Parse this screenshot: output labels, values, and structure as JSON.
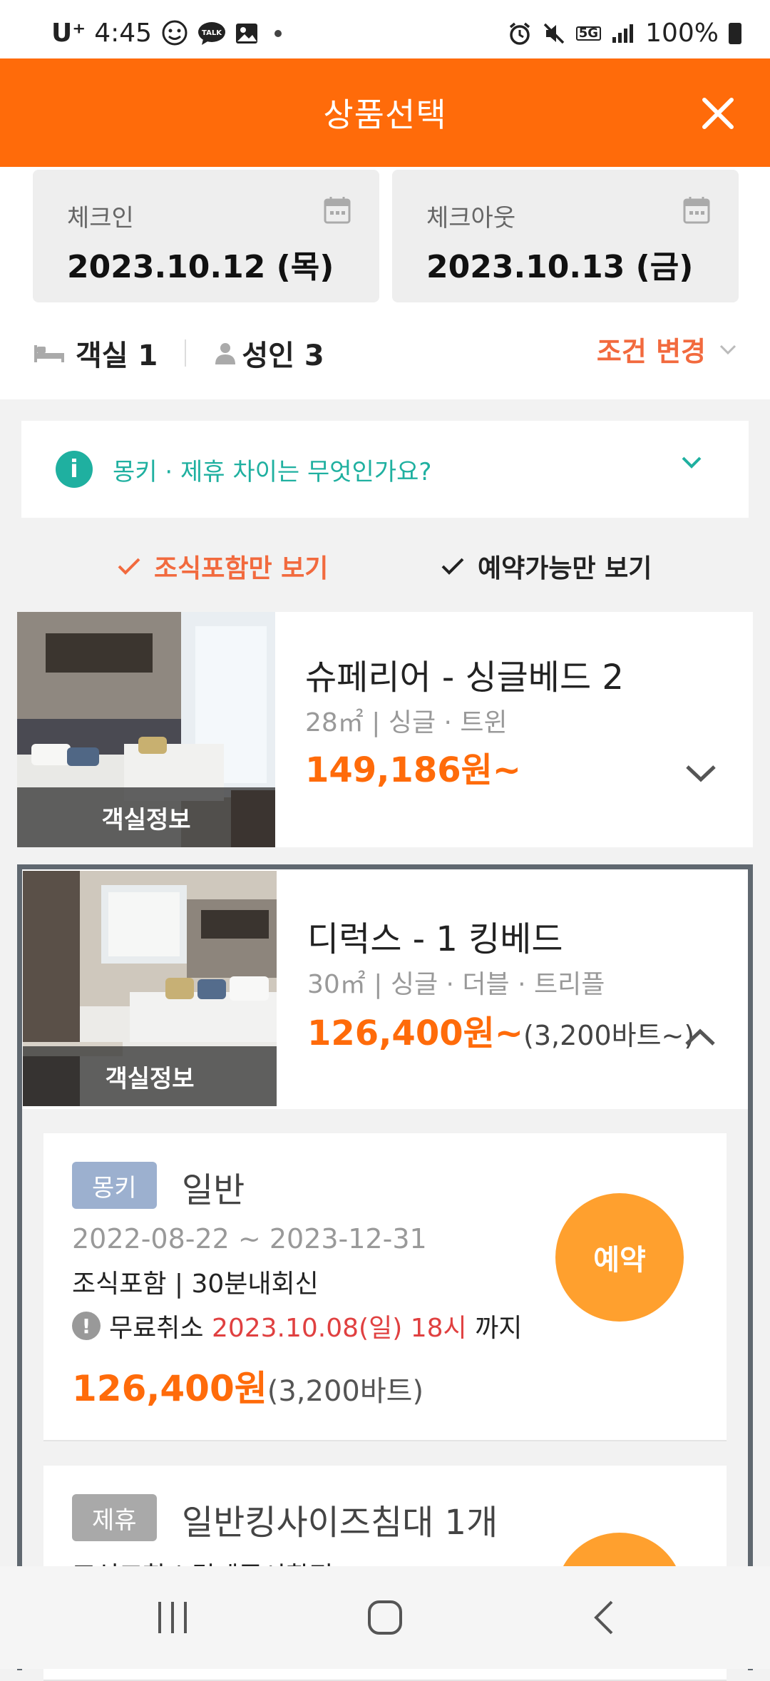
{
  "status_bar": {
    "carrier": "U⁺",
    "time": "4:45",
    "network": "5G",
    "battery": "100%",
    "left_icons": [
      "smiley-app-icon",
      "talk-bubble-icon",
      "gallery-icon",
      "dot"
    ],
    "right_icons": [
      "alarm-icon",
      "mute-icon",
      "5g-icon",
      "signal-icon",
      "battery-icon"
    ]
  },
  "header": {
    "title": "상품선택"
  },
  "dates": {
    "checkin_label": "체크인",
    "checkin_value": "2023.10.12 (목)",
    "checkout_label": "체크아웃",
    "checkout_value": "2023.10.13 (금)"
  },
  "conditions": {
    "rooms": "객실 1",
    "adults": "성인 3",
    "change_label": "조건 변경"
  },
  "info": {
    "text": "몽키 · 제휴 차이는 무엇인가요?"
  },
  "filters": [
    {
      "label": "조식포함만 보기",
      "active": true
    },
    {
      "label": "예약가능만 보기",
      "active": false
    }
  ],
  "rooms": [
    {
      "image_label": "객실정보",
      "name": "슈페리어 - 싱글베드 2",
      "sub": "28㎡ | 싱글 · 트윈",
      "price": "149,186원~",
      "price_extra": "",
      "expanded": false
    },
    {
      "image_label": "객실정보",
      "name": "디럭스 - 1 킹베드",
      "sub": "30㎡ | 싱글 · 더블 · 트리플",
      "price": "126,400원~",
      "price_extra": "(3,200바트~)",
      "expanded": true
    }
  ],
  "plans": [
    {
      "badge": "몽키",
      "badge_color": "#9cb0cf",
      "name": "일반",
      "period": "2022-08-22 ~ 2023-12-31",
      "features": "조식포함 | 30분내회신",
      "cancel_prefix": "무료취소 ",
      "cancel_date": "2023.10.08(일) 18시",
      "cancel_suffix": " 까지",
      "price": "126,400원",
      "price_extra": "(3,200바트)",
      "button": "예약"
    },
    {
      "badge": "제휴",
      "badge_color": "#a9a9a9",
      "name": "일반킹사이즈침대 1개",
      "features": "조식포함 | 결제즉시확정"
    }
  ],
  "colors": {
    "brand": "#ff6b0a",
    "accent_red": "#f26a3e",
    "teal": "#1fb0a0",
    "reserve": "#ffa02e"
  }
}
